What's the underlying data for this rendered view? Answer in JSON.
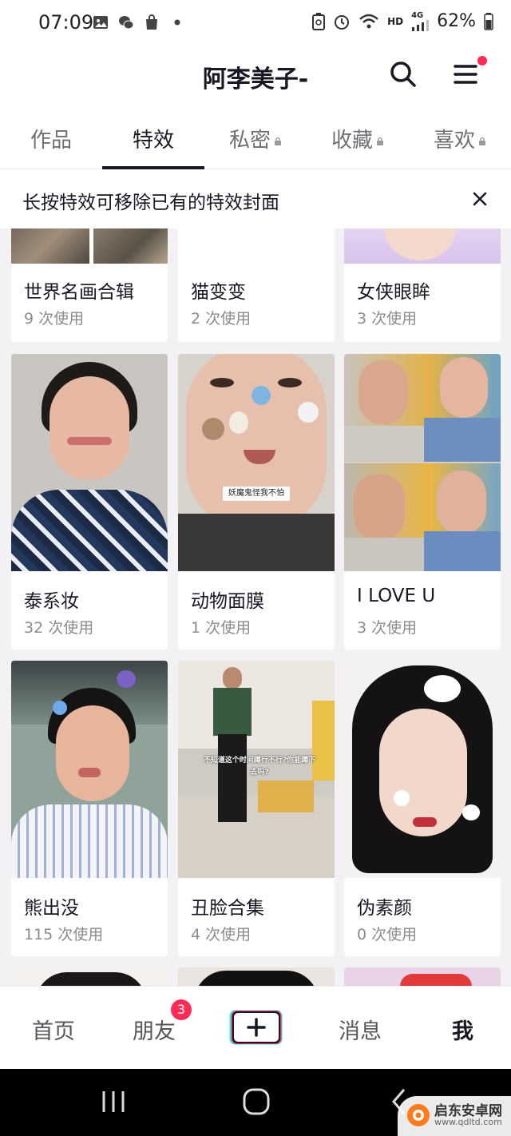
{
  "status_bar": {
    "time": "07:09",
    "network": "HD",
    "signal_type": "4G",
    "battery": "62%"
  },
  "header": {
    "title": "阿李美子-"
  },
  "tabs": [
    {
      "label": "作品",
      "locked": false,
      "active": false
    },
    {
      "label": "特效",
      "locked": false,
      "active": true
    },
    {
      "label": "私密",
      "locked": true,
      "active": false
    },
    {
      "label": "收藏",
      "locked": true,
      "active": false
    },
    {
      "label": "喜欢",
      "locked": true,
      "active": false
    }
  ],
  "notice": {
    "text": "长按特效可移除已有的特效封面"
  },
  "effects": [
    {
      "name": "世界名画合辑",
      "usage": "9 次使用"
    },
    {
      "name": "猫变变",
      "usage": "2 次使用"
    },
    {
      "name": "女侠眼眸",
      "usage": "3 次使用"
    },
    {
      "name": "泰系妆",
      "usage": "32 次使用"
    },
    {
      "name": "动物面膜",
      "usage": "1 次使用",
      "overlay": "妖魔鬼怪我不怕"
    },
    {
      "name": "I LOVE U",
      "usage": "3 次使用"
    },
    {
      "name": "熊出没",
      "usage": "115 次使用"
    },
    {
      "name": "丑脸合集",
      "usage": "4 次使用",
      "overlay": "不知道这个时间蹲行不行?你能蹲下去吗?"
    },
    {
      "name": "伪素颜",
      "usage": "0 次使用"
    }
  ],
  "bottom_nav": {
    "home": "首页",
    "friends": "朋友",
    "friends_badge": "3",
    "messages": "消息",
    "me": "我"
  },
  "watermark": {
    "title": "启东安卓网",
    "url": "www.qdltd.com"
  },
  "colors": {
    "accent": "#fe2c55",
    "text": "#161823",
    "muted": "#8a8b91",
    "background_grid": "#f2f2f4"
  }
}
